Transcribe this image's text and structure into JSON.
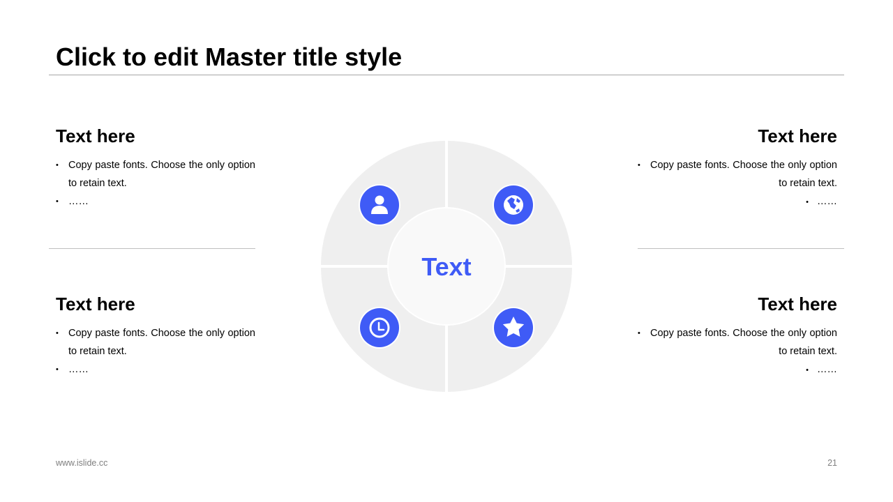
{
  "slide": {
    "title": "Click to edit Master title style",
    "center_label": "Text",
    "accent_color": "#3f5bf6",
    "quadrant_color": "#efefef",
    "center_color": "#f9f9f9"
  },
  "blocks": {
    "top_left": {
      "heading": "Text here",
      "bullet_1": "Copy paste fonts. Choose the only option to retain text.",
      "bullet_2": "……"
    },
    "top_right": {
      "heading": "Text here",
      "bullet_1": "Copy paste fonts. Choose the only option to retain text.",
      "bullet_2": "……"
    },
    "bottom_left": {
      "heading": "Text here",
      "bullet_1": "Copy paste fonts. Choose the only option to retain text.",
      "bullet_2": "……"
    },
    "bottom_right": {
      "heading": "Text here",
      "bullet_1": "Copy paste fonts. Choose the only option to retain text.",
      "bullet_2": "……"
    }
  },
  "icons": {
    "top_left": "user-icon",
    "top_right": "globe-icon",
    "bottom_left": "clock-icon",
    "bottom_right": "star-icon"
  },
  "footer": {
    "url": "www.islide.cc",
    "page_number": "21"
  }
}
